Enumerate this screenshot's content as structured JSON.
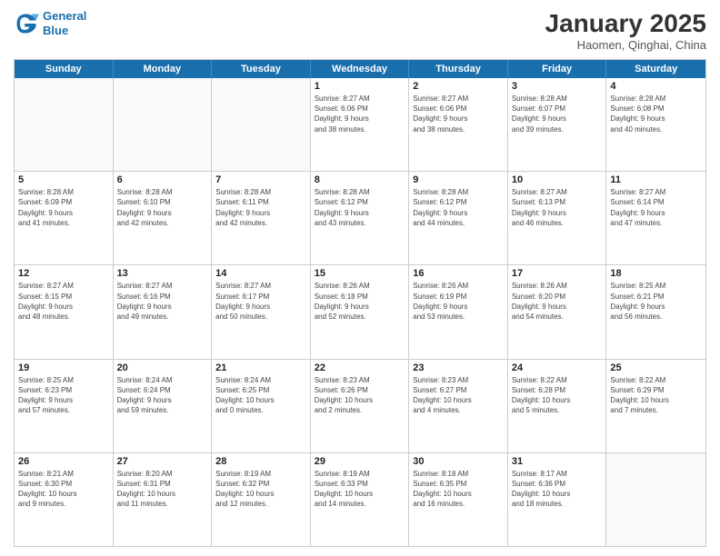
{
  "header": {
    "logo_line1": "General",
    "logo_line2": "Blue",
    "title": "January 2025",
    "location": "Haomen, Qinghai, China"
  },
  "days": [
    "Sunday",
    "Monday",
    "Tuesday",
    "Wednesday",
    "Thursday",
    "Friday",
    "Saturday"
  ],
  "weeks": [
    [
      {
        "num": "",
        "info": ""
      },
      {
        "num": "",
        "info": ""
      },
      {
        "num": "",
        "info": ""
      },
      {
        "num": "1",
        "info": "Sunrise: 8:27 AM\nSunset: 6:06 PM\nDaylight: 9 hours\nand 38 minutes."
      },
      {
        "num": "2",
        "info": "Sunrise: 8:27 AM\nSunset: 6:06 PM\nDaylight: 9 hours\nand 38 minutes."
      },
      {
        "num": "3",
        "info": "Sunrise: 8:28 AM\nSunset: 6:07 PM\nDaylight: 9 hours\nand 39 minutes."
      },
      {
        "num": "4",
        "info": "Sunrise: 8:28 AM\nSunset: 6:08 PM\nDaylight: 9 hours\nand 40 minutes."
      }
    ],
    [
      {
        "num": "5",
        "info": "Sunrise: 8:28 AM\nSunset: 6:09 PM\nDaylight: 9 hours\nand 41 minutes."
      },
      {
        "num": "6",
        "info": "Sunrise: 8:28 AM\nSunset: 6:10 PM\nDaylight: 9 hours\nand 42 minutes."
      },
      {
        "num": "7",
        "info": "Sunrise: 8:28 AM\nSunset: 6:11 PM\nDaylight: 9 hours\nand 42 minutes."
      },
      {
        "num": "8",
        "info": "Sunrise: 8:28 AM\nSunset: 6:12 PM\nDaylight: 9 hours\nand 43 minutes."
      },
      {
        "num": "9",
        "info": "Sunrise: 8:28 AM\nSunset: 6:12 PM\nDaylight: 9 hours\nand 44 minutes."
      },
      {
        "num": "10",
        "info": "Sunrise: 8:27 AM\nSunset: 6:13 PM\nDaylight: 9 hours\nand 46 minutes."
      },
      {
        "num": "11",
        "info": "Sunrise: 8:27 AM\nSunset: 6:14 PM\nDaylight: 9 hours\nand 47 minutes."
      }
    ],
    [
      {
        "num": "12",
        "info": "Sunrise: 8:27 AM\nSunset: 6:15 PM\nDaylight: 9 hours\nand 48 minutes."
      },
      {
        "num": "13",
        "info": "Sunrise: 8:27 AM\nSunset: 6:16 PM\nDaylight: 9 hours\nand 49 minutes."
      },
      {
        "num": "14",
        "info": "Sunrise: 8:27 AM\nSunset: 6:17 PM\nDaylight: 9 hours\nand 50 minutes."
      },
      {
        "num": "15",
        "info": "Sunrise: 8:26 AM\nSunset: 6:18 PM\nDaylight: 9 hours\nand 52 minutes."
      },
      {
        "num": "16",
        "info": "Sunrise: 8:26 AM\nSunset: 6:19 PM\nDaylight: 9 hours\nand 53 minutes."
      },
      {
        "num": "17",
        "info": "Sunrise: 8:26 AM\nSunset: 6:20 PM\nDaylight: 9 hours\nand 54 minutes."
      },
      {
        "num": "18",
        "info": "Sunrise: 8:25 AM\nSunset: 6:21 PM\nDaylight: 9 hours\nand 56 minutes."
      }
    ],
    [
      {
        "num": "19",
        "info": "Sunrise: 8:25 AM\nSunset: 6:23 PM\nDaylight: 9 hours\nand 57 minutes."
      },
      {
        "num": "20",
        "info": "Sunrise: 8:24 AM\nSunset: 6:24 PM\nDaylight: 9 hours\nand 59 minutes."
      },
      {
        "num": "21",
        "info": "Sunrise: 8:24 AM\nSunset: 6:25 PM\nDaylight: 10 hours\nand 0 minutes."
      },
      {
        "num": "22",
        "info": "Sunrise: 8:23 AM\nSunset: 6:26 PM\nDaylight: 10 hours\nand 2 minutes."
      },
      {
        "num": "23",
        "info": "Sunrise: 8:23 AM\nSunset: 6:27 PM\nDaylight: 10 hours\nand 4 minutes."
      },
      {
        "num": "24",
        "info": "Sunrise: 8:22 AM\nSunset: 6:28 PM\nDaylight: 10 hours\nand 5 minutes."
      },
      {
        "num": "25",
        "info": "Sunrise: 8:22 AM\nSunset: 6:29 PM\nDaylight: 10 hours\nand 7 minutes."
      }
    ],
    [
      {
        "num": "26",
        "info": "Sunrise: 8:21 AM\nSunset: 6:30 PM\nDaylight: 10 hours\nand 9 minutes."
      },
      {
        "num": "27",
        "info": "Sunrise: 8:20 AM\nSunset: 6:31 PM\nDaylight: 10 hours\nand 11 minutes."
      },
      {
        "num": "28",
        "info": "Sunrise: 8:19 AM\nSunset: 6:32 PM\nDaylight: 10 hours\nand 12 minutes."
      },
      {
        "num": "29",
        "info": "Sunrise: 8:19 AM\nSunset: 6:33 PM\nDaylight: 10 hours\nand 14 minutes."
      },
      {
        "num": "30",
        "info": "Sunrise: 8:18 AM\nSunset: 6:35 PM\nDaylight: 10 hours\nand 16 minutes."
      },
      {
        "num": "31",
        "info": "Sunrise: 8:17 AM\nSunset: 6:36 PM\nDaylight: 10 hours\nand 18 minutes."
      },
      {
        "num": "",
        "info": ""
      }
    ]
  ]
}
